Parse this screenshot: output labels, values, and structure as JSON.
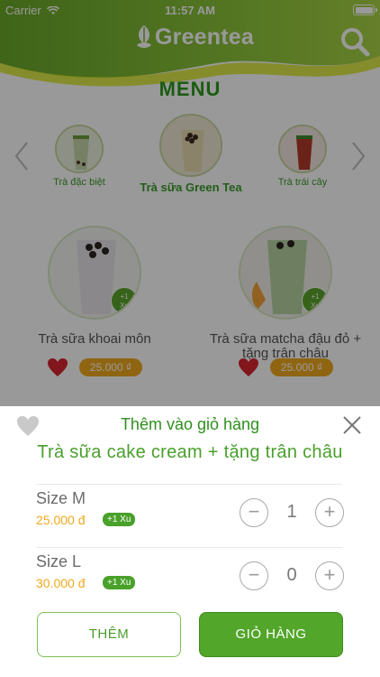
{
  "status_bar": {
    "carrier": "Carrier",
    "time": "11:57 AM"
  },
  "header": {
    "logo_text": "Greentea",
    "search_icon": "search-icon"
  },
  "menu": {
    "title": "MENU",
    "categories": [
      {
        "label": "Trà đặc biệt"
      },
      {
        "label": "Trà sữa Green Tea",
        "active": true
      },
      {
        "label": "Trà trái cây"
      }
    ]
  },
  "products": [
    {
      "name": "Trà sữa khoai môn",
      "price": "25.000 ₫",
      "xu_line1": "+1",
      "xu_line2": "Xu"
    },
    {
      "name": "Trà sữa matcha đậu đỏ + tặng trân châu",
      "price": "25.000 ₫",
      "xu_line1": "+1",
      "xu_line2": "Xu"
    }
  ],
  "sheet": {
    "title": "Thêm vào giỏ hàng",
    "product_name": "Trà sữa cake cream + tặng trân châu",
    "sizes": [
      {
        "name": "Size M",
        "price": "25.000 đ",
        "xu": "+1 Xu",
        "quantity": "1"
      },
      {
        "name": "Size L",
        "price": "30.000 đ",
        "xu": "+1 Xu",
        "quantity": "0"
      }
    ],
    "stepper_minus": "−",
    "stepper_plus": "+",
    "add_button": "THÊM",
    "cart_button": "GIỎ HÀNG"
  },
  "colors": {
    "brand_green": "#52a62a",
    "price_orange": "#f1a81d",
    "heart_red": "#d8262f"
  }
}
